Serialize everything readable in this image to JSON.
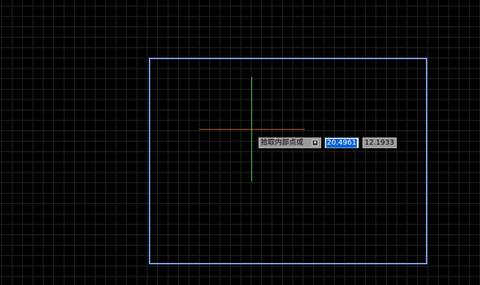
{
  "prompt": {
    "text": "拾取内部点或",
    "option_icon": "options-arrow-icon",
    "option_glyph": "▾"
  },
  "coordinates": {
    "x": "20.4961",
    "y": "12.1933"
  },
  "colors": {
    "background": "#000000",
    "grid": "#262626",
    "boundary": "#7f9cf0",
    "crosshair_x_axis": "#c85a3a",
    "crosshair_y_axis": "#4fc24f",
    "selection": "#0a64d6"
  }
}
